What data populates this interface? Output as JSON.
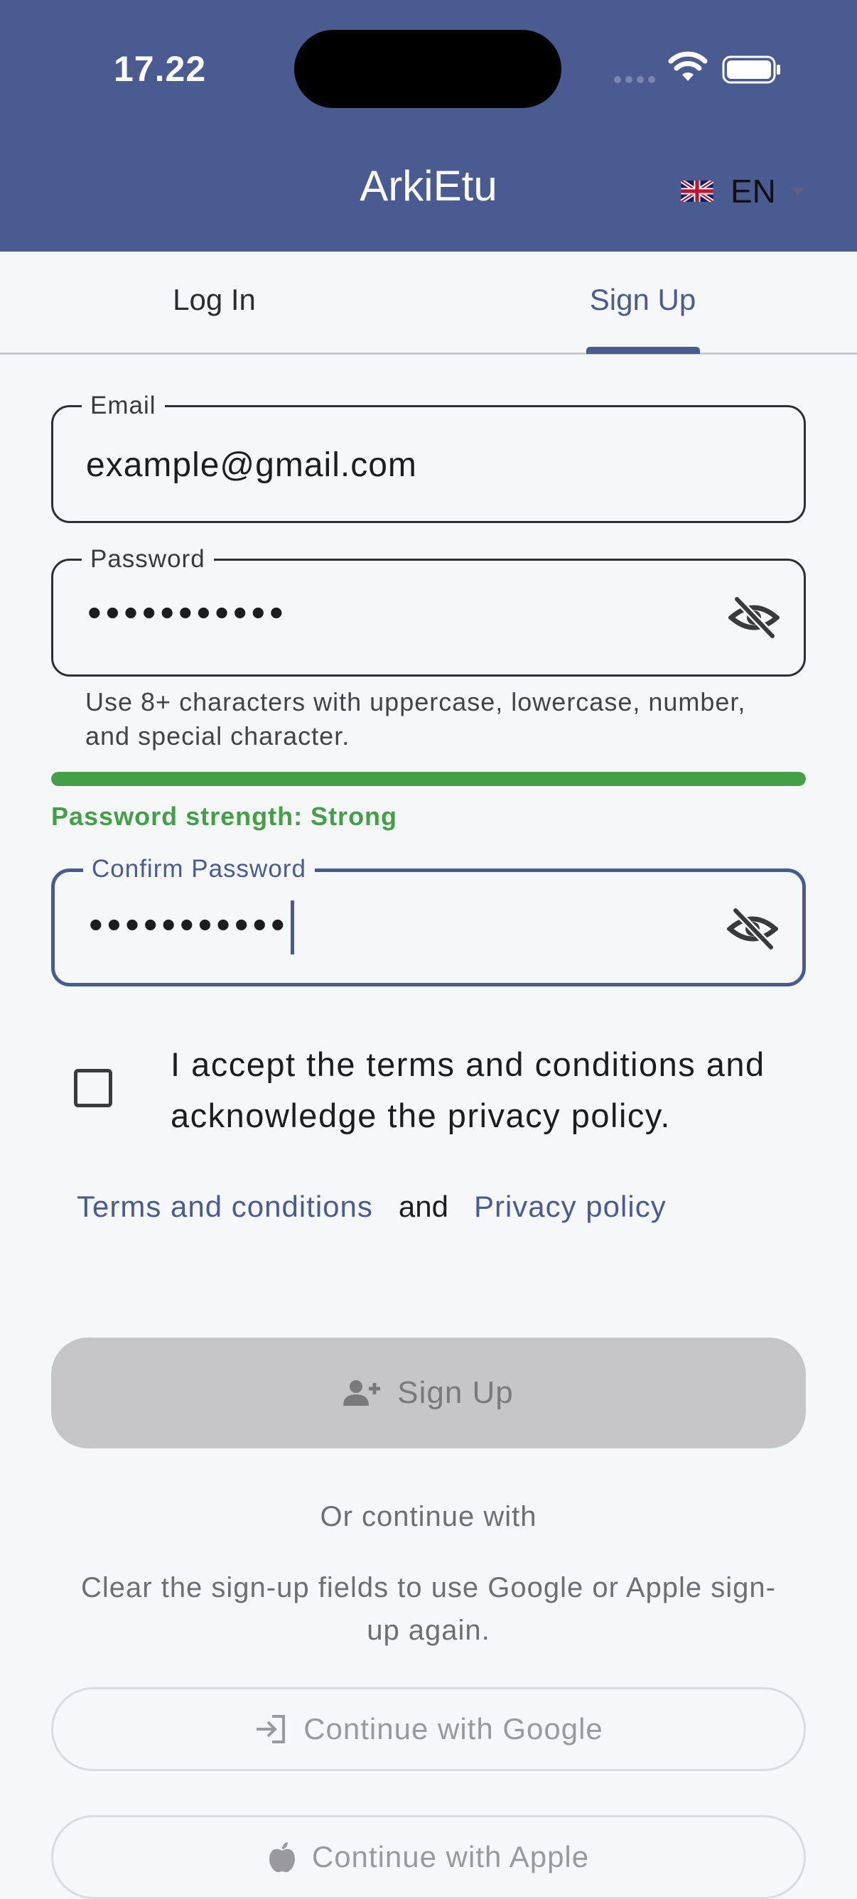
{
  "status": {
    "time": "17.22"
  },
  "header": {
    "title": "ArkiEtu",
    "language_code": "EN"
  },
  "tabs": [
    {
      "label": "Log In"
    },
    {
      "label": "Sign Up"
    }
  ],
  "form": {
    "email": {
      "label": "Email",
      "value": "example@gmail.com"
    },
    "password": {
      "label": "Password",
      "masked_value": "•••••••••••"
    },
    "password_hint": "Use 8+ characters with uppercase, lowercase, number, and special character.",
    "strength": {
      "text": "Password strength: Strong",
      "level": 1.0,
      "color": "#43a047"
    },
    "confirm_password": {
      "label": "Confirm Password",
      "masked_value": "•••••••••••"
    },
    "terms_text": "I accept the terms and conditions and acknowledge the privacy policy.",
    "terms_link": "Terms and conditions",
    "and_text": "and",
    "privacy_link": "Privacy policy"
  },
  "actions": {
    "signup_label": "Sign Up",
    "or_text": "Or continue with",
    "clear_text": "Clear the sign-up fields to use Google or Apple sign-up again.",
    "google_label": "Continue with Google",
    "apple_label": "Continue with Apple"
  },
  "colors": {
    "brand": "#4a5b92",
    "success": "#43a047",
    "disabled": "#c6c6c8"
  }
}
